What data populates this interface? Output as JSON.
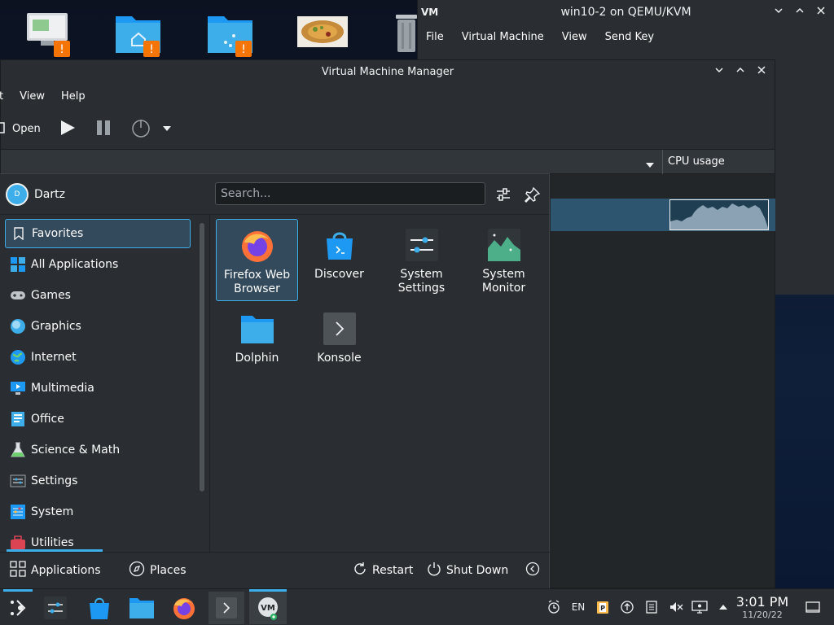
{
  "desktop": {
    "icons": [
      "computer-icon",
      "home-folder-icon",
      "network-folder-icon",
      "food-image-icon",
      "trash-icon"
    ]
  },
  "vm_console": {
    "title": "win10-2 on QEMU/KVM",
    "menu": [
      "File",
      "Virtual Machine",
      "View",
      "Send Key"
    ]
  },
  "vmm": {
    "title": "Virtual Machine Manager",
    "menu": [
      "t",
      "View",
      "Help"
    ],
    "toolbar": {
      "open_label": "Open"
    },
    "column_header": "CPU usage"
  },
  "launcher": {
    "user_name": "Dartz",
    "user_initial": "D",
    "search_placeholder": "Search...",
    "categories": [
      {
        "label": "Favorites",
        "icon": "bookmark-icon"
      },
      {
        "label": "All Applications",
        "icon": "grid-apps-icon"
      },
      {
        "label": "Games",
        "icon": "gamepad-icon"
      },
      {
        "label": "Graphics",
        "icon": "graphics-icon"
      },
      {
        "label": "Internet",
        "icon": "globe-icon"
      },
      {
        "label": "Multimedia",
        "icon": "monitor-icon"
      },
      {
        "label": "Office",
        "icon": "office-icon"
      },
      {
        "label": "Science & Math",
        "icon": "flask-icon"
      },
      {
        "label": "Settings",
        "icon": "settings-icon"
      },
      {
        "label": "System",
        "icon": "system-icon"
      },
      {
        "label": "Utilities",
        "icon": "toolbox-icon"
      }
    ],
    "apps": [
      {
        "label": "Firefox Web Browser",
        "icon": "firefox-icon"
      },
      {
        "label": "Discover",
        "icon": "discover-icon"
      },
      {
        "label": "System Settings",
        "icon": "system-settings-icon"
      },
      {
        "label": "System Monitor",
        "icon": "system-monitor-icon"
      },
      {
        "label": "Dolphin",
        "icon": "folder-icon"
      },
      {
        "label": "Konsole",
        "icon": "terminal-icon"
      }
    ],
    "footer": {
      "applications_label": "Applications",
      "places_label": "Places",
      "restart_label": "Restart",
      "shutdown_label": "Shut Down"
    }
  },
  "taskbar": {
    "apps": [
      "app-launcher-icon",
      "settings-taskbar-icon",
      "discover-taskbar-icon",
      "dolphin-taskbar-icon",
      "firefox-taskbar-icon",
      "konsole-taskbar-icon",
      "virt-manager-taskbar-icon"
    ],
    "keyboard_layout": "EN",
    "clock_time": "3:01 PM",
    "clock_date": "11/20/22"
  },
  "colors": {
    "accent": "#3daee9",
    "panel": "#2a2e32",
    "selection": "#334a5c"
  }
}
